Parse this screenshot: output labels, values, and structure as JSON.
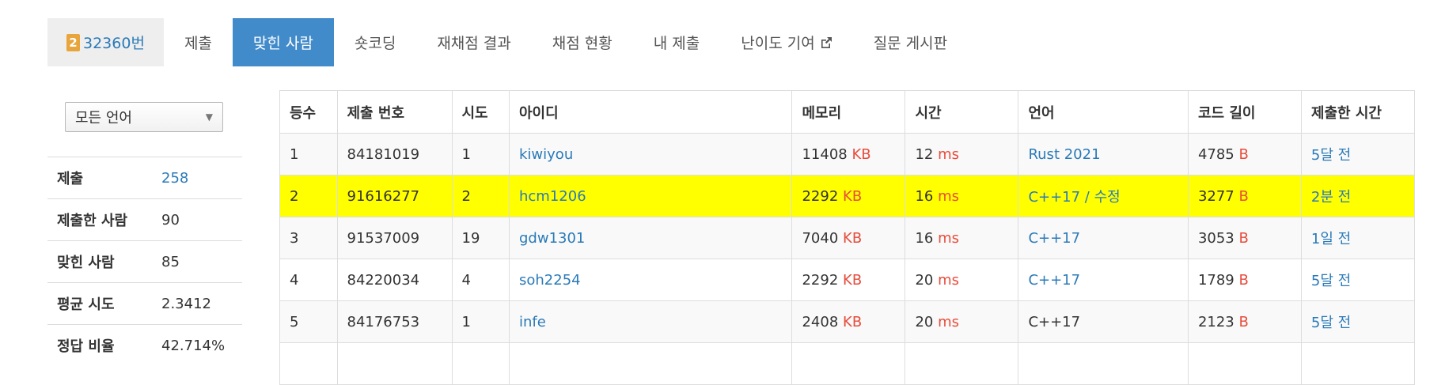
{
  "tabs": {
    "problem_level": "2",
    "problem_label": "32360번",
    "items": [
      "제출",
      "맞힌 사람",
      "숏코딩",
      "재채점 결과",
      "채점 현황",
      "내 제출",
      "난이도 기여",
      "질문 게시판"
    ]
  },
  "sidebar": {
    "language_select": "모든 언어",
    "stats": [
      {
        "label": "제출",
        "value": "258"
      },
      {
        "label": "제출한 사람",
        "value": "90"
      },
      {
        "label": "맞힌 사람",
        "value": "85"
      },
      {
        "label": "평균 시도",
        "value": "2.3412"
      },
      {
        "label": "정답 비율",
        "value": "42.714%"
      }
    ]
  },
  "table": {
    "headers": [
      "등수",
      "제출 번호",
      "시도",
      "아이디",
      "메모리",
      "시간",
      "언어",
      "코드 길이",
      "제출한 시간"
    ],
    "units": {
      "memory": "KB",
      "time": "ms",
      "code": "B"
    },
    "rows": [
      {
        "rank": "1",
        "submission": "84181019",
        "tries": "1",
        "user": "kiwiyou",
        "memory": "11408",
        "time": "12",
        "language": "Rust 2021",
        "code_length": "4785",
        "submitted": "5달 전"
      },
      {
        "rank": "2",
        "submission": "91616277",
        "tries": "2",
        "user": "hcm1206",
        "memory": "2292",
        "time": "16",
        "language": "C++17 / 수정",
        "code_length": "3277",
        "submitted": "2분 전"
      },
      {
        "rank": "3",
        "submission": "91537009",
        "tries": "19",
        "user": "gdw1301",
        "memory": "7040",
        "time": "16",
        "language": "C++17",
        "code_length": "3053",
        "submitted": "1일 전"
      },
      {
        "rank": "4",
        "submission": "84220034",
        "tries": "4",
        "user": "soh2254",
        "memory": "2292",
        "time": "20",
        "language": "C++17",
        "code_length": "1789",
        "submitted": "5달 전"
      },
      {
        "rank": "5",
        "submission": "84176753",
        "tries": "1",
        "user": "infe",
        "memory": "2408",
        "time": "20",
        "language": "C++17",
        "code_length": "2123",
        "submitted": "5달 전"
      }
    ]
  },
  "colors": {
    "accent": "#428bca",
    "link": "#2a7ab8",
    "unit": "#e74c3c",
    "highlight": "#ffff00",
    "badge": "#e8a53b"
  }
}
